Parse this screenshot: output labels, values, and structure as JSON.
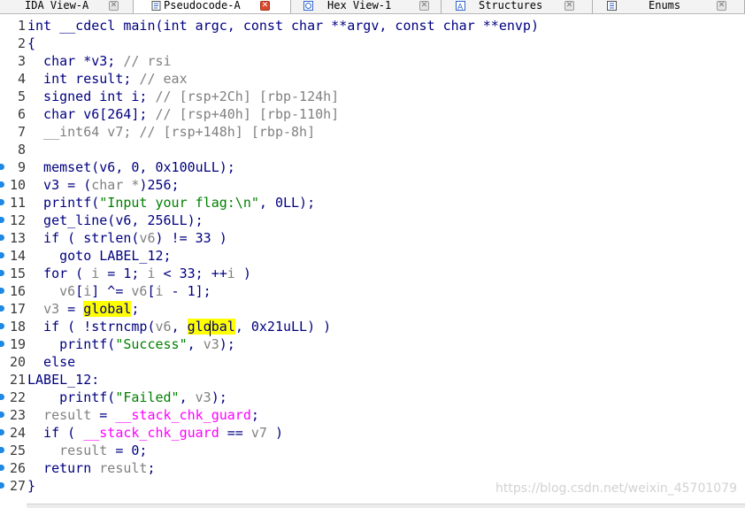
{
  "tabs": [
    {
      "label": "IDA View-A",
      "icon": "ida-view-icon",
      "active": false
    },
    {
      "label": "Pseudocode-A",
      "icon": "pseudocode-icon",
      "active": true
    },
    {
      "label": "Hex View-1",
      "icon": "hex-view-icon",
      "active": false
    },
    {
      "label": "Structures",
      "icon": "structures-icon",
      "active": false
    },
    {
      "label": "Enums",
      "icon": "enums-icon",
      "active": false
    }
  ],
  "code_lines": [
    {
      "num": "1",
      "bp": false,
      "tokens": [
        {
          "t": "int __cdecl main(int argc, const char **argv, const char **envp)",
          "c": "plain"
        }
      ]
    },
    {
      "num": "2",
      "bp": false,
      "tokens": [
        {
          "t": "{",
          "c": "plain"
        }
      ]
    },
    {
      "num": "3",
      "bp": false,
      "tokens": [
        {
          "t": "  char *v3; ",
          "c": "plain"
        },
        {
          "t": "// rsi",
          "c": "cmt"
        }
      ]
    },
    {
      "num": "4",
      "bp": false,
      "tokens": [
        {
          "t": "  int result; ",
          "c": "plain"
        },
        {
          "t": "// eax",
          "c": "cmt"
        }
      ]
    },
    {
      "num": "5",
      "bp": false,
      "tokens": [
        {
          "t": "  signed int i; ",
          "c": "plain"
        },
        {
          "t": "// [rsp+2Ch] [rbp-124h]",
          "c": "cmt"
        }
      ]
    },
    {
      "num": "6",
      "bp": false,
      "tokens": [
        {
          "t": "  char v6[264]; ",
          "c": "plain"
        },
        {
          "t": "// [rsp+40h] [rbp-110h]",
          "c": "cmt"
        }
      ]
    },
    {
      "num": "7",
      "bp": false,
      "tokens": [
        {
          "t": "  __int64 v7; ",
          "c": "var"
        },
        {
          "t": "// [rsp+148h] [rbp-8h]",
          "c": "cmt"
        }
      ]
    },
    {
      "num": "8",
      "bp": false,
      "tokens": [
        {
          "t": "",
          "c": "plain"
        }
      ]
    },
    {
      "num": "9",
      "bp": true,
      "tokens": [
        {
          "t": "  memset(v6, 0, 0x100uLL);",
          "c": "plain"
        }
      ]
    },
    {
      "num": "10",
      "bp": true,
      "tokens": [
        {
          "t": "  v3 = (",
          "c": "plain"
        },
        {
          "t": "char *",
          "c": "var"
        },
        {
          "t": ")256;",
          "c": "plain"
        }
      ]
    },
    {
      "num": "11",
      "bp": true,
      "tokens": [
        {
          "t": "  printf(",
          "c": "plain"
        },
        {
          "t": "\"Input your flag:\\n\"",
          "c": "str"
        },
        {
          "t": ", 0LL);",
          "c": "plain"
        }
      ]
    },
    {
      "num": "12",
      "bp": true,
      "tokens": [
        {
          "t": "  get_line(v6, 256LL);",
          "c": "plain"
        }
      ]
    },
    {
      "num": "13",
      "bp": true,
      "tokens": [
        {
          "t": "  if ( strlen(",
          "c": "plain"
        },
        {
          "t": "v6",
          "c": "var"
        },
        {
          "t": ") != 33 )",
          "c": "plain"
        }
      ]
    },
    {
      "num": "14",
      "bp": true,
      "tokens": [
        {
          "t": "    goto LABEL_12;",
          "c": "plain"
        }
      ]
    },
    {
      "num": "15",
      "bp": true,
      "tokens": [
        {
          "t": "  for ( ",
          "c": "plain"
        },
        {
          "t": "i",
          "c": "var"
        },
        {
          "t": " = 1; ",
          "c": "plain"
        },
        {
          "t": "i",
          "c": "var"
        },
        {
          "t": " < 33; ++",
          "c": "plain"
        },
        {
          "t": "i",
          "c": "var"
        },
        {
          "t": " )",
          "c": "plain"
        }
      ]
    },
    {
      "num": "16",
      "bp": true,
      "tokens": [
        {
          "t": "    ",
          "c": "plain"
        },
        {
          "t": "v6",
          "c": "var"
        },
        {
          "t": "[",
          "c": "plain"
        },
        {
          "t": "i",
          "c": "var"
        },
        {
          "t": "] ^= ",
          "c": "plain"
        },
        {
          "t": "v6",
          "c": "var"
        },
        {
          "t": "[",
          "c": "plain"
        },
        {
          "t": "i",
          "c": "var"
        },
        {
          "t": " - 1];",
          "c": "plain"
        }
      ]
    },
    {
      "num": "17",
      "bp": true,
      "tokens": [
        {
          "t": "  ",
          "c": "plain"
        },
        {
          "t": "v3",
          "c": "var"
        },
        {
          "t": " = ",
          "c": "plain"
        },
        {
          "t": "global",
          "c": "hl"
        },
        {
          "t": ";",
          "c": "plain"
        }
      ]
    },
    {
      "num": "18",
      "bp": true,
      "tokens": [
        {
          "t": "  if ( !strncmp(",
          "c": "plain"
        },
        {
          "t": "v6",
          "c": "var"
        },
        {
          "t": ", ",
          "c": "plain"
        },
        {
          "t": "global",
          "c": "hl"
        },
        {
          "t": ", 0x21uLL) )",
          "c": "plain"
        }
      ]
    },
    {
      "num": "19",
      "bp": true,
      "tokens": [
        {
          "t": "    printf(",
          "c": "plain"
        },
        {
          "t": "\"Success\"",
          "c": "str"
        },
        {
          "t": ", ",
          "c": "plain"
        },
        {
          "t": "v3",
          "c": "var"
        },
        {
          "t": ");",
          "c": "plain"
        }
      ]
    },
    {
      "num": "20",
      "bp": false,
      "tokens": [
        {
          "t": "  else",
          "c": "plain"
        }
      ]
    },
    {
      "num": "21",
      "bp": false,
      "tokens": [
        {
          "t": "LABEL_12:",
          "c": "plain"
        }
      ]
    },
    {
      "num": "22",
      "bp": true,
      "tokens": [
        {
          "t": "    printf(",
          "c": "plain"
        },
        {
          "t": "\"Failed\"",
          "c": "str"
        },
        {
          "t": ", ",
          "c": "plain"
        },
        {
          "t": "v3",
          "c": "var"
        },
        {
          "t": ");",
          "c": "plain"
        }
      ]
    },
    {
      "num": "23",
      "bp": true,
      "tokens": [
        {
          "t": "  ",
          "c": "plain"
        },
        {
          "t": "result",
          "c": "var"
        },
        {
          "t": " = ",
          "c": "plain"
        },
        {
          "t": "__stack_chk_guard",
          "c": "gbl"
        },
        {
          "t": ";",
          "c": "plain"
        }
      ]
    },
    {
      "num": "24",
      "bp": true,
      "tokens": [
        {
          "t": "  if ( ",
          "c": "plain"
        },
        {
          "t": "__stack_chk_guard",
          "c": "gbl"
        },
        {
          "t": " == ",
          "c": "plain"
        },
        {
          "t": "v7",
          "c": "var"
        },
        {
          "t": " )",
          "c": "plain"
        }
      ]
    },
    {
      "num": "25",
      "bp": true,
      "tokens": [
        {
          "t": "    ",
          "c": "plain"
        },
        {
          "t": "result",
          "c": "var"
        },
        {
          "t": " = 0;",
          "c": "plain"
        }
      ]
    },
    {
      "num": "26",
      "bp": true,
      "tokens": [
        {
          "t": "  return ",
          "c": "plain"
        },
        {
          "t": "result",
          "c": "var"
        },
        {
          "t": ";",
          "c": "plain"
        }
      ]
    },
    {
      "num": "27",
      "bp": true,
      "tokens": [
        {
          "t": "}",
          "c": "plain"
        }
      ]
    }
  ],
  "watermark": "https://blog.csdn.net/weixin_45701079",
  "colors": {
    "code": "#000080",
    "comment": "#808080",
    "string": "#008000",
    "global": "#ff00ff",
    "highlight": "#ffff00",
    "breakpoint_marker": "#1e88e5"
  }
}
